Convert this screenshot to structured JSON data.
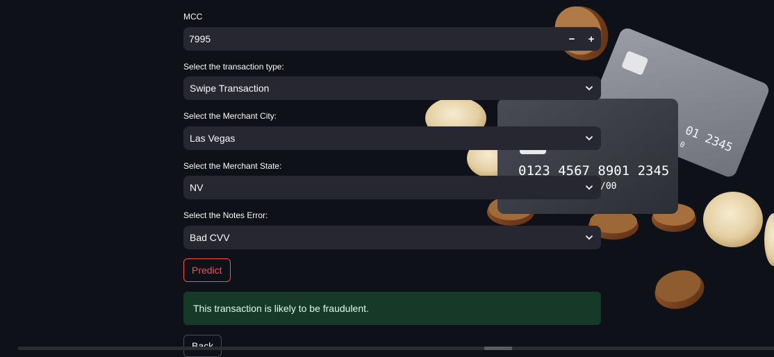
{
  "form": {
    "mcc": {
      "label": "MCC",
      "value": "7995",
      "minus": "−",
      "plus": "+"
    },
    "transaction_type": {
      "label": "Select the transaction type:",
      "value": "Swipe Transaction"
    },
    "merchant_city": {
      "label": "Select the Merchant City:",
      "value": "Las Vegas"
    },
    "merchant_state": {
      "label": "Select the Merchant State:",
      "value": "NV"
    },
    "notes_error": {
      "label": "Select the Notes Error:",
      "value": "Bad CVV"
    },
    "predict_label": "Predict",
    "result_message": "This transaction is likely to be fraudulent.",
    "back_label": "Back"
  },
  "background": {
    "card_front_number": "0123 4567 8901 2345",
    "card_front_expiry": "/00",
    "card_back_number": "01 2345",
    "card_back_fragment": "0"
  },
  "colors": {
    "page_bg": "#0e1117",
    "field_bg": "#262730",
    "accent_red": "#ff4b4b",
    "success_bg": "#173928",
    "success_text": "#dffde9"
  }
}
